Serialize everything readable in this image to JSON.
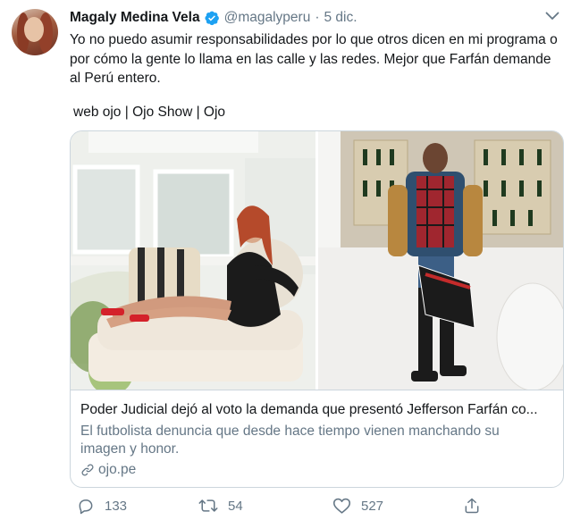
{
  "tweet": {
    "author_name": "Magaly Medina Vela",
    "author_handle": "@magalyperu",
    "separator": "·",
    "date": "5 dic.",
    "text": "Yo no puedo asumir responsabilidades por lo que otros dicen en mi programa o por cómo la gente lo llama en las calle y las redes. Mejor que Farfán demande al Perú entero.",
    "tags": "web ojo | Ojo Show | Ojo"
  },
  "card": {
    "title": "Poder Judicial dejó al voto la demanda que presentó Jefferson Farfán co...",
    "description": "El futbolista denuncia que desde hace tiempo vienen manchando su imagen y honor.",
    "link": "ojo.pe"
  },
  "actions": {
    "replies": "133",
    "retweets": "54",
    "likes": "527"
  },
  "colors": {
    "text": "#14171a",
    "muted": "#657786",
    "verified": "#1da1f2",
    "border": "#ccd6dd"
  },
  "icons": [
    "verified-badge-icon",
    "caret-down-icon",
    "link-icon",
    "reply-icon",
    "retweet-icon",
    "like-icon",
    "share-icon"
  ]
}
